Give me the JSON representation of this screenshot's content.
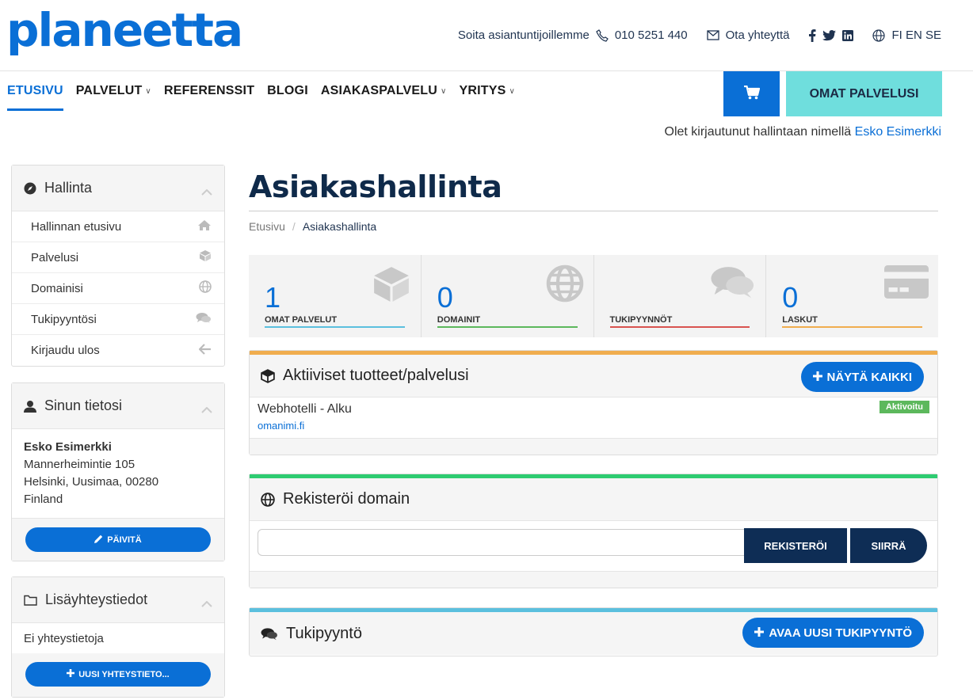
{
  "brand": {
    "logo": "planeetta",
    "accent": "#0a6fd6",
    "mint": "#6fdedd",
    "navy": "#0e2d55"
  },
  "topbar": {
    "call_text": "Soita asiantuntijoillemme",
    "phone": "010 5251 440",
    "contact": "Ota yhteyttä",
    "languages": "FI EN SE"
  },
  "nav": {
    "items": [
      {
        "label": "ETUSIVU",
        "active": true,
        "dropdown": false
      },
      {
        "label": "PALVELUT",
        "active": false,
        "dropdown": true
      },
      {
        "label": "REFERENSSIT",
        "active": false,
        "dropdown": false
      },
      {
        "label": "BLOGI",
        "active": false,
        "dropdown": false
      },
      {
        "label": "ASIAKASPALVELU",
        "active": false,
        "dropdown": true
      },
      {
        "label": "YRITYS",
        "active": false,
        "dropdown": true
      }
    ],
    "omat_palvelusi": "OMAT PALVELUSI",
    "cart_icon": "cart-icon"
  },
  "login": {
    "prefix": "Olet kirjautunut hallintaan nimellä",
    "user": "Esko Esimerkki"
  },
  "sidebar": {
    "hallinta": {
      "title": "Hallinta",
      "items": [
        {
          "label": "Hallinnan etusivu",
          "icon": "home-icon"
        },
        {
          "label": "Palvelusi",
          "icon": "cube-icon"
        },
        {
          "label": "Domainisi",
          "icon": "globe-icon"
        },
        {
          "label": "Tukipyyntösi",
          "icon": "comments-icon"
        },
        {
          "label": "Kirjaudu ulos",
          "icon": "arrow-left-icon"
        }
      ]
    },
    "tiedot": {
      "title": "Sinun tietosi",
      "name": "Esko Esimerkki",
      "street": "Mannerheimintie 105",
      "city": "Helsinki, Uusimaa, 00280",
      "country": "Finland",
      "button": "PÄIVITÄ"
    },
    "lisa": {
      "title": "Lisäyhteystiedot",
      "empty": "Ei yhteystietoja",
      "button": "UUSI YHTEYSTIETO..."
    }
  },
  "main": {
    "title": "Asiakashallinta",
    "breadcrumb": {
      "home": "Etusivu",
      "current": "Asiakashallinta"
    },
    "tiles": [
      {
        "value": "1",
        "label": "OMAT PALVELUT",
        "color": "#5bc0de",
        "icon": "cube-icon"
      },
      {
        "value": "0",
        "label": "DOMAINIT",
        "color": "#5cb85c",
        "icon": "globe-icon"
      },
      {
        "value": "",
        "label": "TUKIPYYNNÖT",
        "color": "#d9534f",
        "icon": "comments-icon"
      },
      {
        "value": "0",
        "label": "LASKUT",
        "color": "#f0ad4e",
        "icon": "credit-card-icon"
      }
    ],
    "active_services": {
      "title": "Aktiiviset tuotteet/palvelusi",
      "button": "NÄYTÄ KAIKKI",
      "color": "#f0ad4e",
      "service": {
        "name": "Webhotelli - Alku",
        "domain": "omanimi.fi",
        "status": "Aktivoitu"
      }
    },
    "register_domain": {
      "title": "Rekisteröi domain",
      "color": "#2ecc71",
      "input_value": "",
      "register": "REKISTERÖI",
      "transfer": "SIIRRÄ"
    },
    "support": {
      "title": "Tukipyyntö",
      "color": "#5bc0de",
      "button": "AVAA UUSI TUKIPYYNTÖ"
    }
  }
}
